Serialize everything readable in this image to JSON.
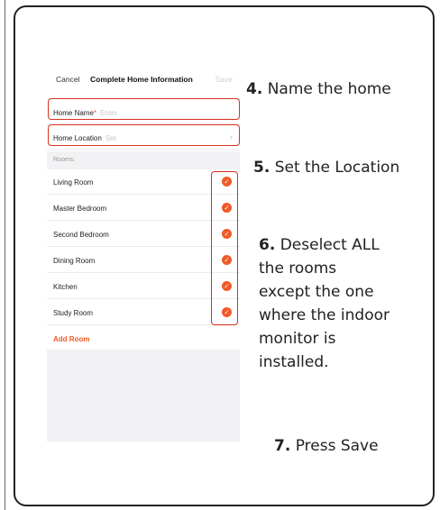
{
  "phone": {
    "nav": {
      "cancel": "Cancel",
      "title": "Complete Home Information",
      "save": "Save"
    },
    "home_name": {
      "label": "Home Name",
      "required_mark": "*",
      "placeholder": "Enter"
    },
    "home_location": {
      "label": "Home Location",
      "placeholder": "Set",
      "chevron": "›"
    },
    "rooms_header": "Rooms:",
    "rooms": [
      {
        "name": "Living Room",
        "checked": true
      },
      {
        "name": "Master Bedroom",
        "checked": true
      },
      {
        "name": "Second Bedroom",
        "checked": true
      },
      {
        "name": "Dining Room",
        "checked": true
      },
      {
        "name": "Kitchen",
        "checked": true
      },
      {
        "name": "Study Room",
        "checked": true
      }
    ],
    "check_glyph": "✓",
    "add_room": "Add Room"
  },
  "steps": [
    {
      "num": "4.",
      "text": "Name the home"
    },
    {
      "num": "5.",
      "text": "Set the Location"
    },
    {
      "num": "6.",
      "text": "Deselect ALL",
      "lines": [
        "the rooms",
        "except the one",
        "where the indoor",
        "monitor is",
        "installed."
      ]
    },
    {
      "num": "7.",
      "text": "Press Save"
    }
  ],
  "colors": {
    "accent": "#ef5a28",
    "highlight": "#d9301f"
  },
  "icons": [
    "check-circle-icon",
    "chevron-right-icon"
  ]
}
